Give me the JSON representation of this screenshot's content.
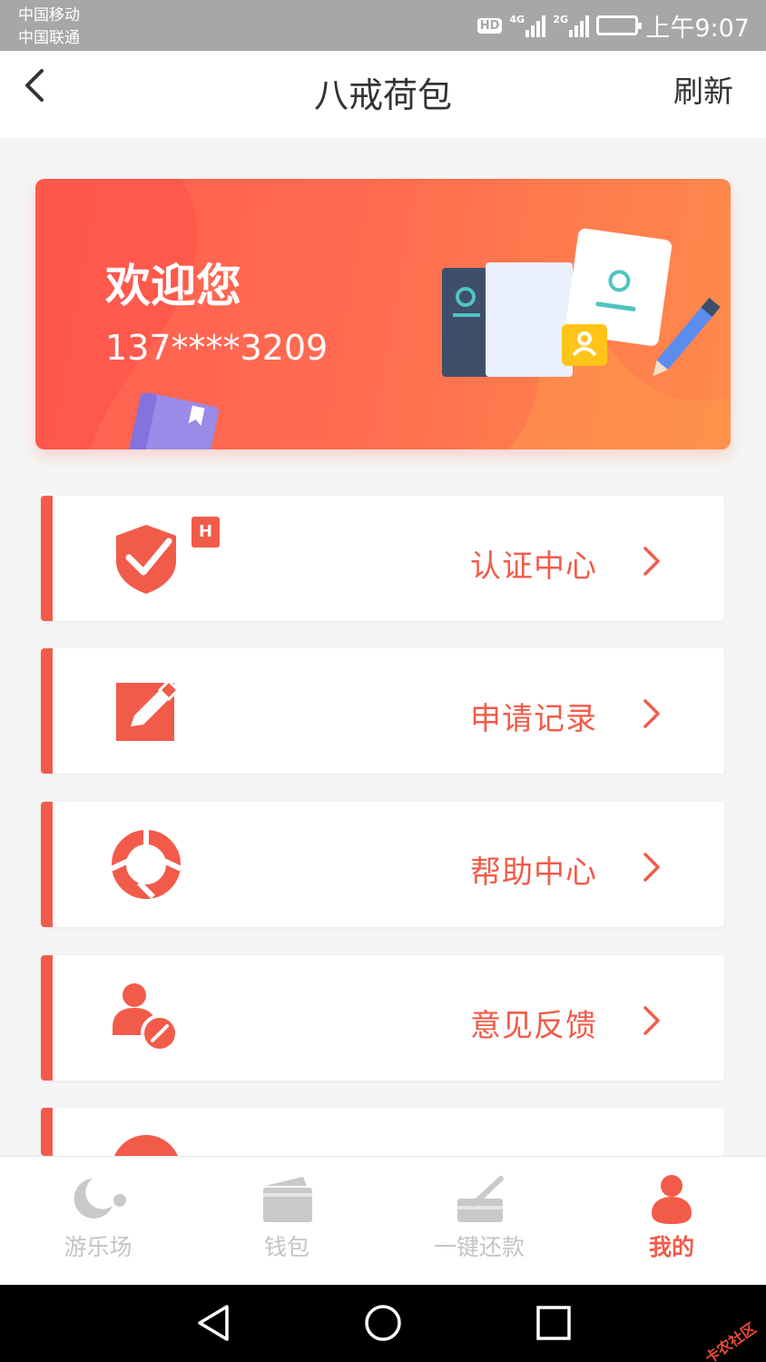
{
  "status_bar": {
    "carrier_1": "中国移动",
    "carrier_2": "中国联通",
    "hd": "HD",
    "net_1": "4G",
    "net_2": "2G",
    "time": "上午9:07"
  },
  "header": {
    "title": "八戒荷包",
    "refresh_label": "刷新",
    "back_icon": "chevron-left-icon"
  },
  "banner": {
    "greeting": "欢迎您",
    "phone": "137****3209"
  },
  "menu": {
    "items": [
      {
        "label": "认证中心",
        "icon": "shield-check-icon",
        "badge": "H"
      },
      {
        "label": "申请记录",
        "icon": "edit-note-icon"
      },
      {
        "label": "帮助中心",
        "icon": "lifebuoy-icon"
      },
      {
        "label": "意见反馈",
        "icon": "user-feedback-icon"
      }
    ]
  },
  "tabbar": {
    "tabs": [
      {
        "label": "游乐场",
        "icon": "moon-planet-icon",
        "active": false
      },
      {
        "label": "钱包",
        "icon": "wallet-icon",
        "active": false
      },
      {
        "label": "一键还款",
        "icon": "repay-icon",
        "active": false
      },
      {
        "label": "我的",
        "icon": "user-icon",
        "active": true
      }
    ]
  },
  "watermark": "卡农社区",
  "colors": {
    "accent": "#f25b4a",
    "banner_start": "#ff5f52",
    "banner_end": "#ff8a4c",
    "inactive": "#c4c4c4"
  }
}
